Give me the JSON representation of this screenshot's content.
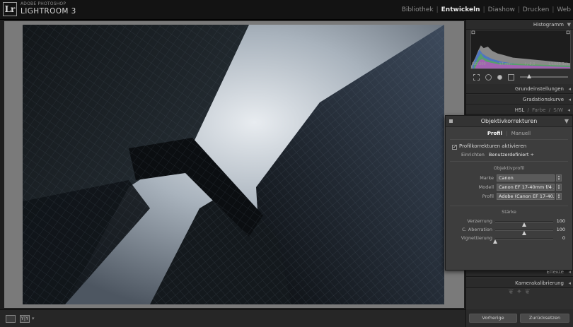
{
  "app": {
    "logo_text": "Lr",
    "brand_sub": "ADOBE PHOTOSHOP",
    "brand_main": "LIGHTROOM 3"
  },
  "modules": [
    {
      "label": "Bibliothek",
      "active": false
    },
    {
      "label": "Entwickeln",
      "active": true
    },
    {
      "label": "Diashow",
      "active": false
    },
    {
      "label": "Drucken",
      "active": false
    },
    {
      "label": "Web",
      "active": false
    }
  ],
  "right_panel": {
    "histogram_title": "Histogramm",
    "histogram_info": [
      "ISO 200",
      "17 mm",
      "f / 8,0",
      "1/1000 Sek."
    ],
    "sections": {
      "basic": "Grundeinstellungen",
      "tone_curve": "Gradationskurve",
      "hsl": "HSL",
      "color": "Farbe",
      "sw": "S/W",
      "effects": "Effekte",
      "camera_calibration": "Kamerakalibrierung"
    },
    "buttons": {
      "previous": "Vorherige",
      "reset": "Zurücksetzen"
    }
  },
  "lens_panel": {
    "title": "Objektivkorrekturen",
    "tabs": [
      {
        "label": "Profil",
        "active": true
      },
      {
        "label": "Manuell",
        "active": false
      }
    ],
    "enable_profile": {
      "label": "Profilkorrekturen aktivieren",
      "checked": true
    },
    "setup": {
      "label": "Einrichten",
      "value": "Benutzerdefiniert ÷"
    },
    "lens_profile_heading": "Objektivprofil",
    "fields": [
      {
        "label": "Marke",
        "value": "Canon"
      },
      {
        "label": "Modell",
        "value": "Canon EF 17-40mm f/4 ..."
      },
      {
        "label": "Profil",
        "value": "Adobe (Canon EF 17-40..."
      }
    ],
    "amount_heading": "Stärke",
    "sliders": [
      {
        "label": "Verzerrung",
        "value": "100",
        "fraction": 0.5
      },
      {
        "label": "C. Aberration",
        "value": "100",
        "fraction": 0.5
      },
      {
        "label": "Vignettierung",
        "value": "0",
        "fraction": 0.0
      }
    ]
  },
  "toolbar": {
    "compare_label": "Y|Y"
  },
  "icons": [
    "loupe-view-icon",
    "compare-view-icon",
    "crop-tool-icon",
    "spot-removal-icon",
    "redeye-icon",
    "graduated-filter-icon",
    "adjustment-brush-icon",
    "ornament-icon"
  ]
}
